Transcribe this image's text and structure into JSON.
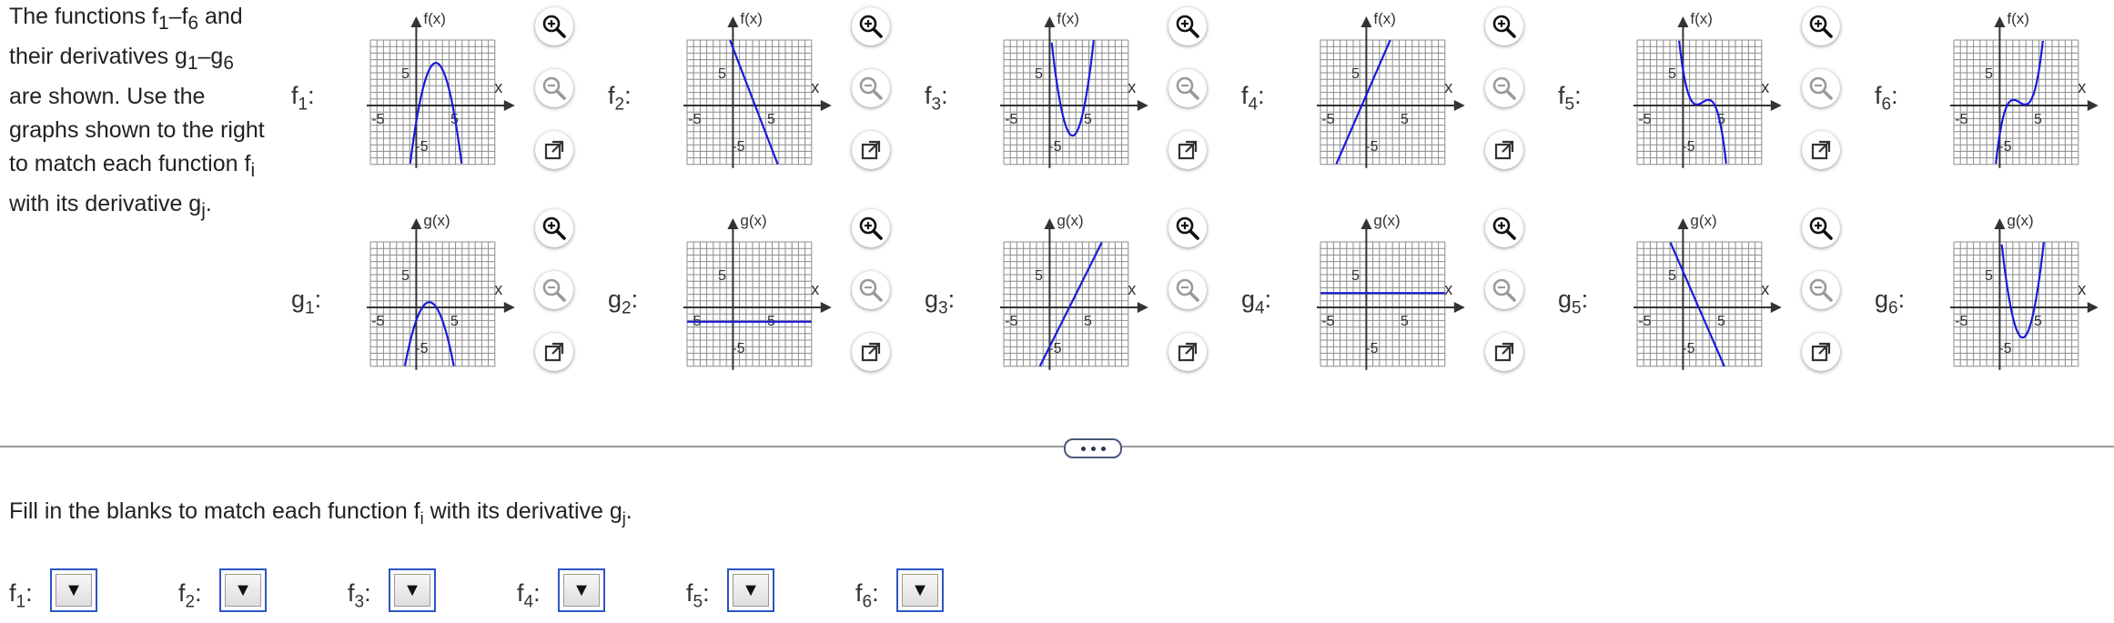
{
  "intro": {
    "line1_a": "The functions f",
    "line1_s1": "1",
    "line1_b": "–f",
    "line1_s2": "6",
    "line1_c": " and",
    "line2_a": "their derivatives g",
    "line2_s1": "1",
    "line2_b": "–g",
    "line2_s2": "6",
    "line3": "are shown. Use the",
    "line4": "graphs shown to the right",
    "line5_a": "to match each function f",
    "line5_s": "i",
    "line6_a": "with its derivative g",
    "line6_s": "j",
    "line6_b": "."
  },
  "axes": {
    "x_label": "x",
    "f_label": "f(x)",
    "g_label": "g(x)",
    "tick_neg": "-5",
    "tick_pos": "5",
    "tick_top": "5",
    "tick_bottom": "-5"
  },
  "tools": {
    "zoom_in": "zoom-in-icon",
    "zoom_out": "zoom-out-icon",
    "popout": "popout-icon",
    "curve_color": "#1a1adc"
  },
  "functions": [
    {
      "letter": "f",
      "sub": "1",
      "curve": "neg-parabola-peak"
    },
    {
      "letter": "f",
      "sub": "2",
      "curve": "steep-decreasing-line"
    },
    {
      "letter": "f",
      "sub": "3",
      "curve": "upward-parabola"
    },
    {
      "letter": "f",
      "sub": "4",
      "curve": "steep-increasing-line"
    },
    {
      "letter": "f",
      "sub": "5",
      "curve": "decreasing-cubic"
    },
    {
      "letter": "f",
      "sub": "6",
      "curve": "increasing-cubic"
    }
  ],
  "derivatives": [
    {
      "letter": "g",
      "sub": "1",
      "curve": "neg-parabola"
    },
    {
      "letter": "g",
      "sub": "2",
      "curve": "horizontal-line-negative"
    },
    {
      "letter": "g",
      "sub": "3",
      "curve": "increasing-line"
    },
    {
      "letter": "g",
      "sub": "4",
      "curve": "horizontal-line-positive"
    },
    {
      "letter": "g",
      "sub": "5",
      "curve": "decreasing-line"
    },
    {
      "letter": "g",
      "sub": "6",
      "curve": "upward-parabola"
    }
  ],
  "instruction": {
    "a": "Fill in the blanks to match each function f",
    "s1": "i",
    "b": " with its derivative g",
    "s2": "j",
    "c": "."
  },
  "answers": [
    {
      "letter": "f",
      "sub": "1",
      "value": "",
      "arrow": "▼"
    },
    {
      "letter": "f",
      "sub": "2",
      "value": "",
      "arrow": "▼"
    },
    {
      "letter": "f",
      "sub": "3",
      "value": "",
      "arrow": "▼"
    },
    {
      "letter": "f",
      "sub": "4",
      "value": "",
      "arrow": "▼"
    },
    {
      "letter": "f",
      "sub": "5",
      "value": "",
      "arrow": "▼"
    },
    {
      "letter": "f",
      "sub": "6",
      "value": "",
      "arrow": "▼"
    }
  ]
}
